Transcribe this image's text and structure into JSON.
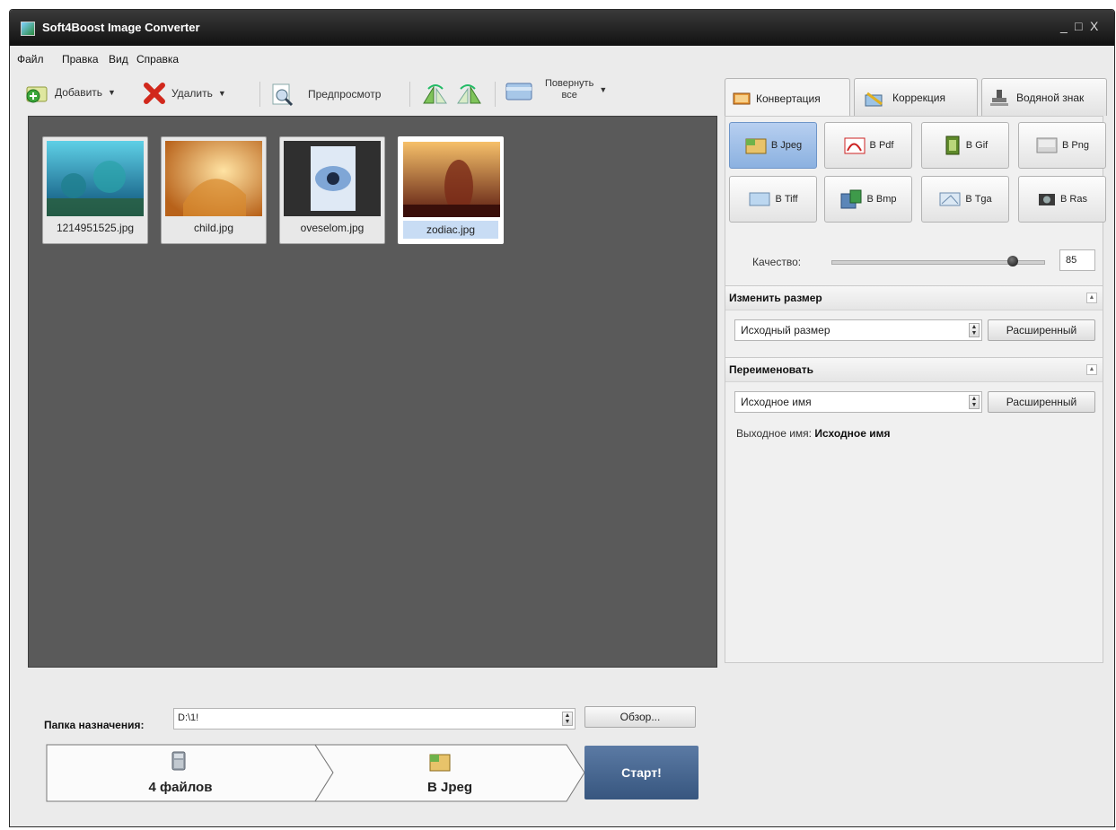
{
  "window": {
    "title": "Soft4Boost Image Converter",
    "controls": [
      "_",
      "□",
      "X"
    ]
  },
  "menu": [
    "Файл",
    "Правка",
    "Вид",
    "Справка"
  ],
  "toolbar": {
    "add": "Добавить",
    "delete": "Удалить",
    "preview": "Предпросмотр",
    "rotate_all_line1": "Повернуть",
    "rotate_all_line2": "все"
  },
  "thumbnails": [
    {
      "name": "1214951525.jpg",
      "selected": false
    },
    {
      "name": "child.jpg",
      "selected": false
    },
    {
      "name": "oveselom.jpg",
      "selected": false
    },
    {
      "name": "zodiac.jpg",
      "selected": true
    }
  ],
  "destination": {
    "label": "Папка назначения:",
    "value": "D:\\1!",
    "browse": "Обзор..."
  },
  "flow": {
    "files": "4 файлов",
    "format": "В Jpeg",
    "start": "Старт!"
  },
  "tabs": [
    {
      "label": "Конвертация",
      "active": true
    },
    {
      "label": "Коррекция",
      "active": false
    },
    {
      "label": "Водяной знак",
      "active": false
    }
  ],
  "formats": [
    {
      "label": "В Jpeg",
      "active": true
    },
    {
      "label": "В Pdf",
      "active": false
    },
    {
      "label": "В Gif",
      "active": false
    },
    {
      "label": "В Png",
      "active": false
    },
    {
      "label": "В Tiff",
      "active": false
    },
    {
      "label": "В Bmp",
      "active": false
    },
    {
      "label": "В Tga",
      "active": false
    },
    {
      "label": "В Ras",
      "active": false
    }
  ],
  "quality": {
    "label": "Качество:",
    "value": "85",
    "level_percent": 85
  },
  "resize": {
    "title": "Изменить размер",
    "option": "Исходный размер",
    "advanced": "Расширенный"
  },
  "rename": {
    "title": "Переименовать",
    "option": "Исходное имя",
    "advanced": "Расширенный",
    "output_label": "Выходное имя:",
    "output_value": "Исходное имя"
  }
}
